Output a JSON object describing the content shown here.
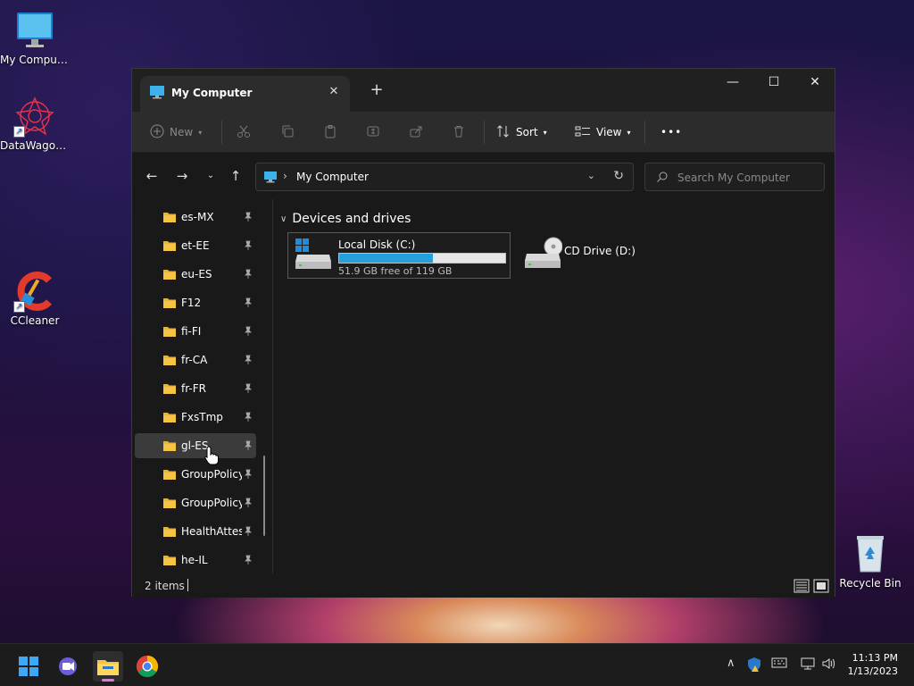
{
  "desktop": {
    "icons": [
      {
        "label": "My Computer"
      },
      {
        "label": "DataWagon..."
      },
      {
        "label": "CCleaner"
      },
      {
        "label": "Recycle Bin"
      }
    ]
  },
  "window": {
    "tab_title": "My Computer",
    "tab_close": "✕",
    "new_tab": "+",
    "minimize": "—",
    "maximize": "☐",
    "close": "✕"
  },
  "toolbar": {
    "new_label": "New",
    "sort_label": "Sort",
    "view_label": "View",
    "more_label": "•••"
  },
  "navbar": {
    "address": "My Computer",
    "search_placeholder": "Search My Computer"
  },
  "sidebar": {
    "items": [
      {
        "label": "es-MX"
      },
      {
        "label": "et-EE"
      },
      {
        "label": "eu-ES"
      },
      {
        "label": "F12"
      },
      {
        "label": "fi-FI"
      },
      {
        "label": "fr-CA"
      },
      {
        "label": "fr-FR"
      },
      {
        "label": "FxsTmp"
      },
      {
        "label": "gl-ES"
      },
      {
        "label": "GroupPolicy"
      },
      {
        "label": "GroupPolicyUsers"
      },
      {
        "label": "HealthAttestation"
      },
      {
        "label": "he-IL"
      }
    ],
    "selected_index": 8
  },
  "content": {
    "group_title": "Devices and drives",
    "drives": [
      {
        "name": "Local Disk (C:)",
        "free_text": "51.9 GB free of 119 GB",
        "used_fraction": 0.564
      },
      {
        "name": "CD Drive (D:)"
      }
    ]
  },
  "status": {
    "item_count": "2 items"
  },
  "taskbar": {
    "clock_time": "11:13 PM",
    "clock_date": "1/13/2023"
  },
  "colors": {
    "accent": "#26a0da",
    "folder": "#f5c444",
    "window_bg": "#191919",
    "toolbar_bg": "#2c2c2c"
  }
}
